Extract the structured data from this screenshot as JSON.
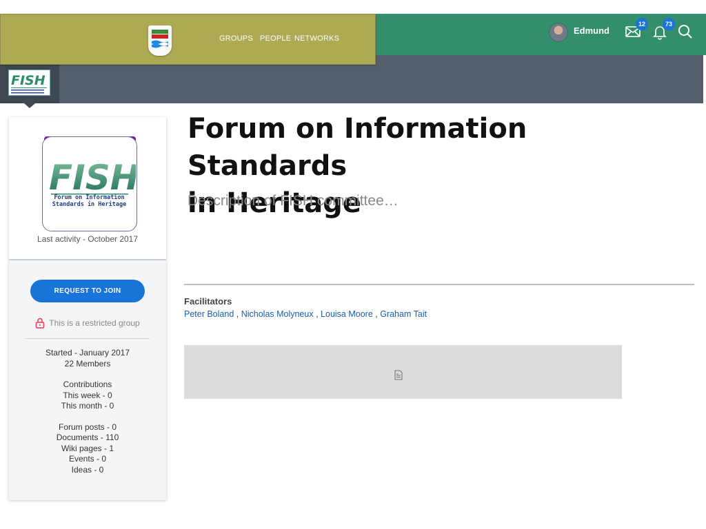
{
  "nav": {
    "items": [
      {
        "label": "GROUPS"
      },
      {
        "label": "PEOPLE"
      },
      {
        "label": "NETWORKS"
      }
    ]
  },
  "user": {
    "name": "Edmund",
    "messages_count": "12",
    "notifications_count": "73"
  },
  "colors": {
    "nav_panel": "#aea953",
    "topbar": "#338e6b",
    "secondary_bar": "#555f6b",
    "accent": "#1a73d9",
    "link": "#1a5fa8"
  },
  "icons": {
    "mail": "mail-icon",
    "bell": "bell-icon",
    "search": "search-icon",
    "lock": "lock-icon",
    "file": "file-icon"
  },
  "group": {
    "logo_text": "FISH",
    "logo_caption": "Forum on Information Standards in Heritage",
    "last_activity": "Last activity - October 2017",
    "join_label": "REQUEST TO JOIN",
    "restricted_text": "This is a restricted group",
    "started": "Started - January 2017",
    "members": "22 Members",
    "contributions_label": "Contributions",
    "this_week": "This week - 0",
    "this_month": "This month - 0",
    "forum_posts": "Forum posts - 0",
    "documents": "Documents - 110",
    "wiki_pages": "Wiki pages - 1",
    "events": "Events - 0",
    "ideas": "Ideas - 0"
  },
  "main": {
    "title_line1": "Forum on Information Standards",
    "title_line2": "in Heritage",
    "description": "Description of FISH committee…",
    "facilitators_label": "Facilitators",
    "facilitators": [
      "Peter Boland",
      "Nicholas Molyneux",
      "Louisa Moore",
      "Graham Tait"
    ],
    "separator": " , "
  }
}
